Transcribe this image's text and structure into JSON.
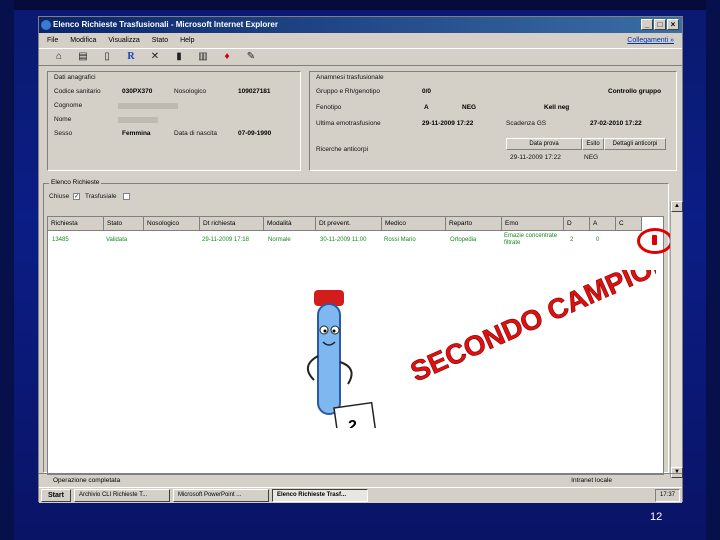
{
  "window": {
    "title": "Elenco Richieste Trasfusionali - Microsoft Internet Explorer",
    "menu": [
      "File",
      "Modifica",
      "Visualizza",
      "Stato",
      "Help"
    ],
    "menu_right": "Collegamenti »"
  },
  "anagrafica": {
    "section_title": "Dati anagrafici",
    "codice_sanitario_label": "Codice sanitario",
    "codice_sanitario_value": "030PX370",
    "nosologico_label": "Nosologico",
    "nosologico_value": "109027181",
    "cognome_label": "Cognome",
    "nome_label": "Nome",
    "sesso_label": "Sesso",
    "sesso_value": "Femmina",
    "data_nascita_label": "Data di nascita",
    "data_nascita_value": "07-09-1990"
  },
  "anamnesi": {
    "section_title": "Anamnesi trasfusionale",
    "gruppo_label": "Gruppo e Rh/genotipo",
    "gruppo_value": "0/0",
    "controllo_label": "Controllo gruppo",
    "fenotipo_label": "Fenotipo",
    "fenotipo_a": "A",
    "fenotipo_b": "NEG",
    "fenotipo_c": "Kell neg",
    "ultima_label": "Ultima emotrasfusione",
    "ultima_value": "29-11-2009 17:22",
    "scadenza_label": "Scadenza GS",
    "scadenza_value": "27-02-2010 17:22",
    "ricerche_label": "Ricerche anticorpi",
    "data_prova_label": "Data prova",
    "esito_label": "Esito",
    "dettaglio_label": "Dettagli anticorpi",
    "data_prova_value": "29-11-2009 17:22",
    "esito_value": "NEG"
  },
  "richieste": {
    "group_title": "Elenco Richieste",
    "chiuse_label": "Chiuse",
    "trasfusiale_label": "Trasfusiale",
    "columns": [
      "Richiesta",
      "Stato",
      "Nosologico",
      "Dt richiesta",
      "Modalità",
      "Dt prevent.",
      "Medico",
      "Reparto",
      "Emo",
      "D",
      "A",
      "C"
    ],
    "row": {
      "richiesta": "13485",
      "stato": "Validata",
      "dt_richiesta": "29-11-2009 17:18",
      "modalita": "Normale",
      "dt_prevent": "30-11-2009 11:00",
      "medico": "Rossi Mario",
      "reparto": "Ortopedia",
      "emo": "Emazie concentrate filtrate",
      "d": "2",
      "a": "0"
    },
    "flag_mark": "!"
  },
  "status": {
    "text": "Operazione completata",
    "zone": "Intranet locale"
  },
  "taskbar": {
    "start": "Start",
    "tasks": [
      "Archivio CLI Richieste T...",
      "Microsoft PowerPoint ...",
      "Elenco Richieste Trasf..."
    ],
    "clock": "17:37"
  },
  "clipart": {
    "calendar_number": "2"
  },
  "overlay_text": "SECONDO CAMPIONE",
  "slide_number": "12",
  "colors": {
    "row_text": "#1a8a1a",
    "highlight": "#e00000",
    "overlay": "#e01010"
  }
}
